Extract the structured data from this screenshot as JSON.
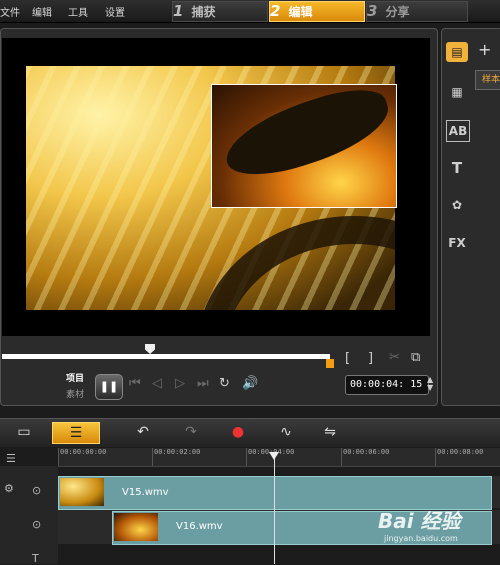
{
  "menu": {
    "file": "文件",
    "edit": "编辑",
    "tools": "工具",
    "settings": "设置"
  },
  "steps": [
    {
      "num": "1",
      "label": "捕获"
    },
    {
      "num": "2",
      "label": "编辑"
    },
    {
      "num": "3",
      "label": "分享"
    }
  ],
  "player": {
    "mode_project": "项目",
    "mode_clip": "素材",
    "play_icon": "pause-icon",
    "timecode": "00:00:04: 15",
    "mark_in": "[",
    "mark_out": "]"
  },
  "library": {
    "add": "+",
    "sample_label": "样本",
    "icons": {
      "media": "media-icon",
      "transition": "transition-icon",
      "title_ab": "AB",
      "text_t": "T",
      "graphic": "graphic-icon",
      "fx": "FX"
    }
  },
  "timeline": {
    "ruler": [
      "00:00:00:00",
      "00:00:02:00",
      "00:00:04:00",
      "00:00:06:00",
      "00:00:08:00"
    ],
    "clips": [
      {
        "name": "V15.wmv"
      },
      {
        "name": "V16.wmv"
      }
    ]
  },
  "watermark": {
    "logo": "Bai 经验",
    "url": "jingyan.baidu.com"
  },
  "colors": {
    "accent": "#f5a623",
    "clip": "#6a9ea3"
  }
}
